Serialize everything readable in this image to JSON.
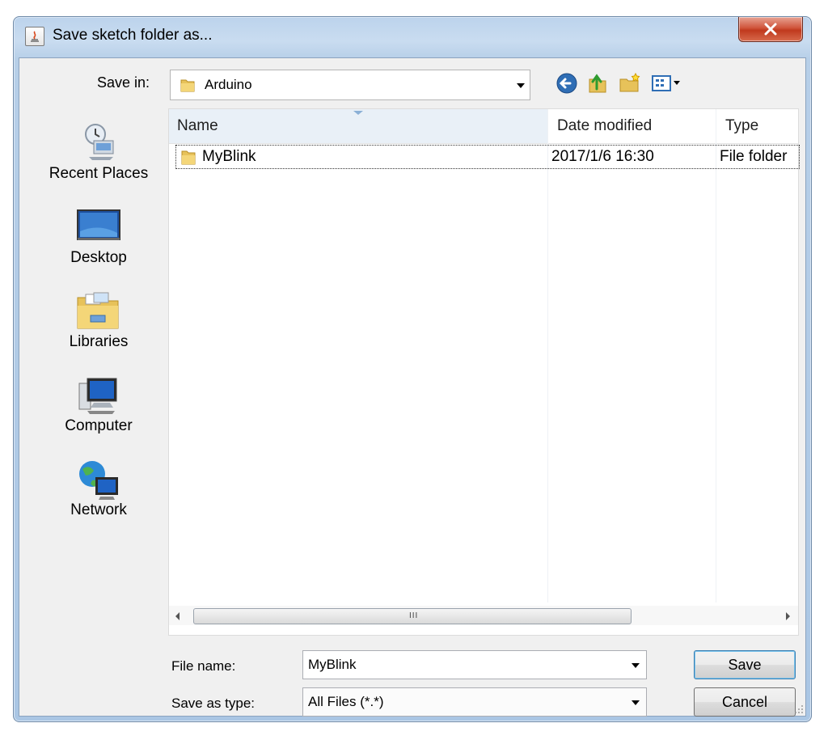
{
  "window": {
    "title": "Save sketch folder as..."
  },
  "toolbar": {
    "save_in_label": "Save in:",
    "save_in_value": "Arduino",
    "icons": [
      "back-icon",
      "up-folder-icon",
      "new-folder-icon",
      "view-menu-icon"
    ]
  },
  "places": [
    {
      "label": "Recent Places",
      "icon": "recent-places-icon"
    },
    {
      "label": "Desktop",
      "icon": "desktop-icon"
    },
    {
      "label": "Libraries",
      "icon": "libraries-icon"
    },
    {
      "label": "Computer",
      "icon": "computer-icon"
    },
    {
      "label": "Network",
      "icon": "network-icon"
    }
  ],
  "file_list": {
    "columns": [
      "Name",
      "Date modified",
      "Type"
    ],
    "rows": [
      {
        "name": "MyBlink",
        "date_modified": "2017/1/6 16:30",
        "type": "File folder"
      }
    ],
    "scrollbar_grip": "III"
  },
  "form": {
    "file_name_label": "File name:",
    "file_name_value": "MyBlink",
    "save_as_type_label": "Save as type:",
    "save_as_type_value": "All Files (*.*)",
    "save_label": "Save",
    "cancel_label": "Cancel"
  },
  "colors": {
    "close_button": "#c7402a",
    "header_highlight": "#e9f0f7",
    "frame": "#b7cfe8"
  }
}
